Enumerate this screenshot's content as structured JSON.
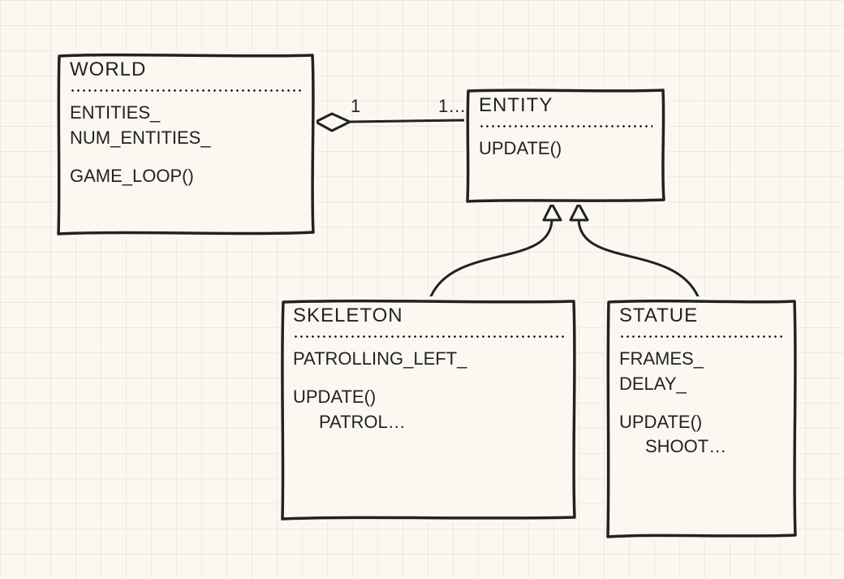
{
  "diagram": {
    "type": "uml-class-diagram",
    "classes": {
      "world": {
        "name": "World",
        "fields": [
          "entities_",
          "num_entities_"
        ],
        "methods": [
          "game_loop()"
        ]
      },
      "entity": {
        "name": "Entity",
        "fields": [],
        "methods": [
          "update()"
        ]
      },
      "skeleton": {
        "name": "Skeleton",
        "fields": [
          "patrolling_left_"
        ],
        "methods": [
          "update()"
        ],
        "method_detail": "patrol…"
      },
      "statue": {
        "name": "Statue",
        "fields": [
          "frames_",
          "delay_"
        ],
        "methods": [
          "update()"
        ],
        "method_detail": "shoot…"
      }
    },
    "relationships": {
      "world_entity": {
        "type": "aggregation",
        "from": "world",
        "to": "entity",
        "multiplicity_from": "1",
        "multiplicity_to": "1…"
      },
      "skeleton_entity": {
        "type": "generalization",
        "from": "skeleton",
        "to": "entity"
      },
      "statue_entity": {
        "type": "generalization",
        "from": "statue",
        "to": "entity"
      }
    }
  }
}
